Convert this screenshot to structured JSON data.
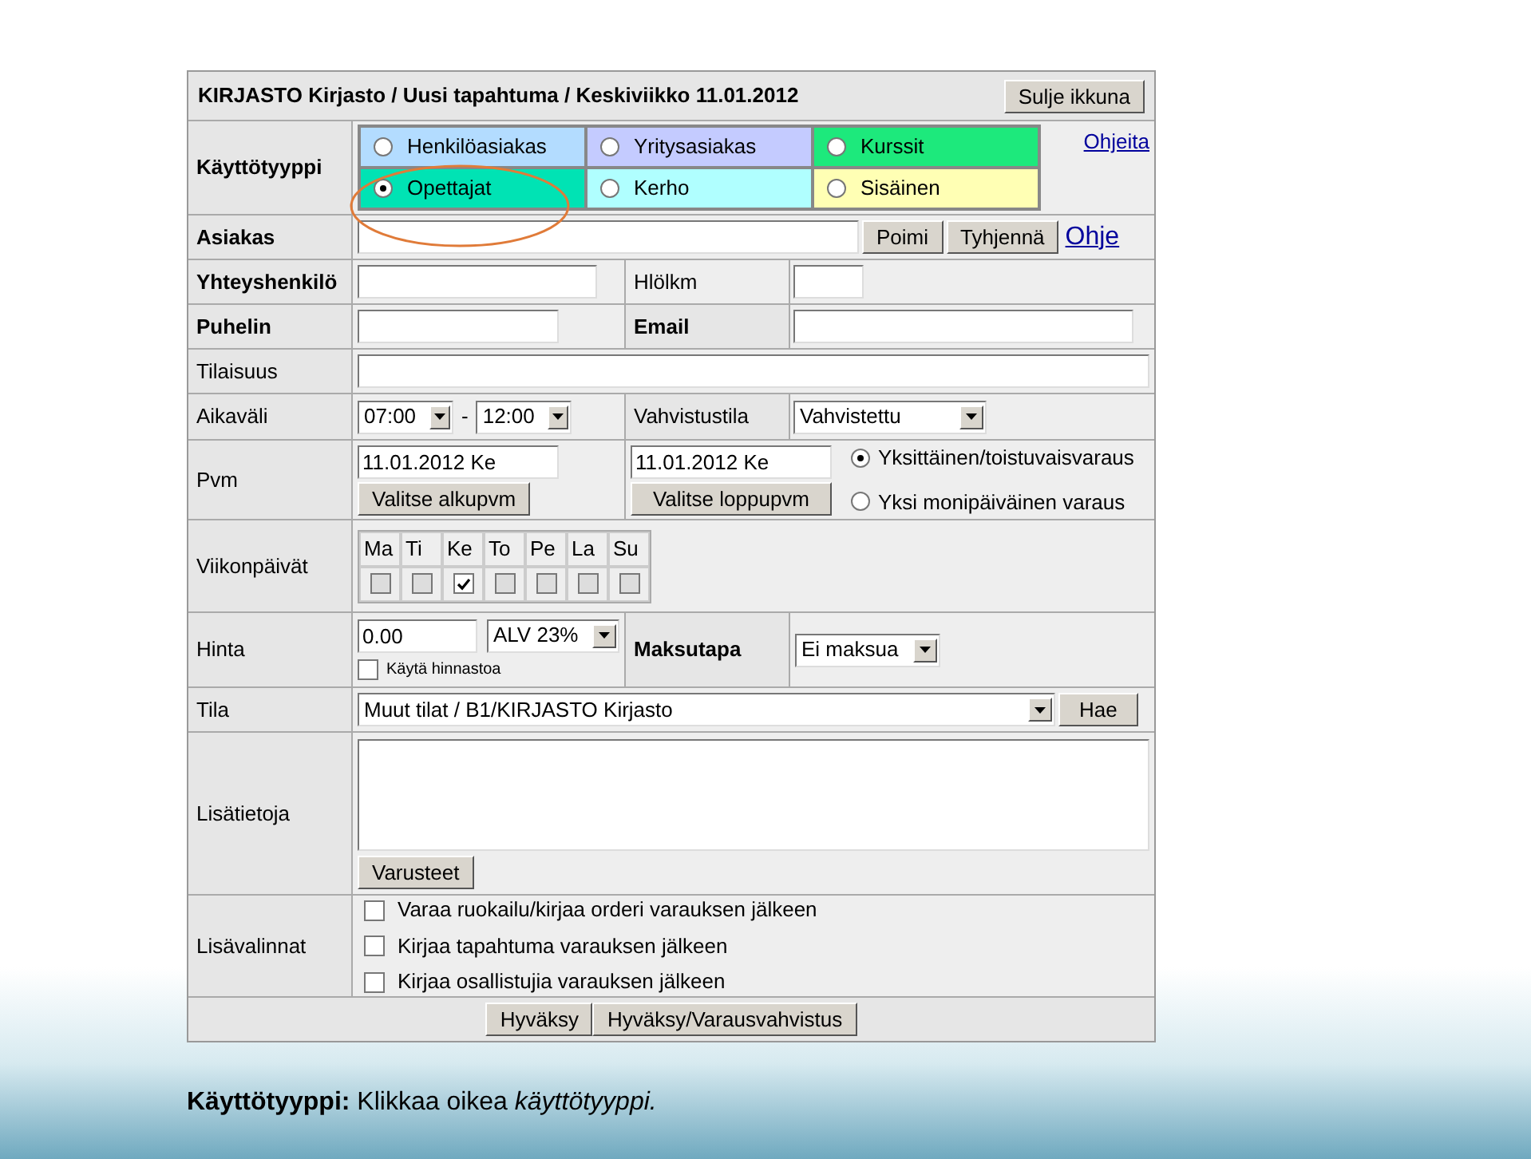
{
  "header": {
    "title": "KIRJASTO Kirjasto / Uusi tapahtuma / Keskiviikko 11.01.2012",
    "close_button": "Sulje ikkuna"
  },
  "usage_type": {
    "label": "Käyttötyyppi",
    "bold": true,
    "help_link": "Ohjeita",
    "options": [
      {
        "label": "Henkilöasiakas",
        "selected": false,
        "color": "#b3dcff"
      },
      {
        "label": "Yritysasiakas",
        "selected": false,
        "color": "#c4cbff"
      },
      {
        "label": "Kurssit",
        "selected": false,
        "color": "#1de97c"
      },
      {
        "label": "Opettajat",
        "selected": true,
        "color": "#00e3b4"
      },
      {
        "label": "Kerho",
        "selected": false,
        "color": "#b0ffff"
      },
      {
        "label": "Sisäinen",
        "selected": false,
        "color": "#ffffb4"
      }
    ]
  },
  "customer": {
    "label": "Asiakas",
    "bold": true,
    "buttons": [
      "Poimi",
      "Tyhjennä"
    ],
    "help_link": "Ohje"
  },
  "contact": {
    "label": "Yhteyshenkilö",
    "bold": true,
    "count_label": "Hlölkm",
    "count_bold": false
  },
  "phone": {
    "label": "Puhelin",
    "bold": true,
    "email_label": "Email",
    "email_bold": true
  },
  "occasion": {
    "label": "Tilaisuus",
    "bold": false
  },
  "time": {
    "label": "Aikaväli",
    "start": "07:00",
    "separator": "-",
    "end": "12:00",
    "status_label": "Vahvistustila",
    "status": "Vahvistettu"
  },
  "date": {
    "label": "Pvm",
    "start": "11.01.2012 Ke",
    "start_button": "Valitse alkupvm",
    "end": "11.01.2012 Ke",
    "end_button": "Valitse loppupvm",
    "types": [
      {
        "label": "Yksittäinen/toistuvaisvaraus",
        "selected": true
      },
      {
        "label": "Yksi monipäiväinen varaus",
        "selected": false
      }
    ]
  },
  "weekdays": {
    "label": "Viikonpäivät",
    "days": [
      {
        "label": "Ma",
        "checked": false
      },
      {
        "label": "Ti",
        "checked": false
      },
      {
        "label": "Ke",
        "checked": true
      },
      {
        "label": "To",
        "checked": false
      },
      {
        "label": "Pe",
        "checked": false
      },
      {
        "label": "La",
        "checked": false
      },
      {
        "label": "Su",
        "checked": false
      }
    ]
  },
  "price": {
    "label": "Hinta",
    "value": "0.00",
    "vat": "ALV 23%",
    "price_list": {
      "label": "Käytä hinnastoa",
      "checked": false
    },
    "payment_label": "Maksutapa",
    "payment_bold": true,
    "payment": "Ei maksua"
  },
  "room": {
    "label": "Tila",
    "value": "Muut tilat / B1/KIRJASTO Kirjasto",
    "button": "Hae"
  },
  "notes": {
    "label": "Lisätietoja",
    "button": "Varusteet"
  },
  "extras": {
    "label": "Lisävalinnat",
    "options": [
      {
        "label": "Varaa ruokailu/kirjaa orderi varauksen jälkeen",
        "checked": false
      },
      {
        "label": "Kirjaa tapahtuma varauksen jälkeen",
        "checked": false
      },
      {
        "label": "Kirjaa osallistujia varauksen jälkeen",
        "checked": false
      }
    ]
  },
  "footer_buttons": [
    "Hyväksy",
    "Hyväksy/Varausvahvistus"
  ],
  "caption": "**Käyttötyyppi:** Klikkaa oikea *käyttötyyppi.*"
}
